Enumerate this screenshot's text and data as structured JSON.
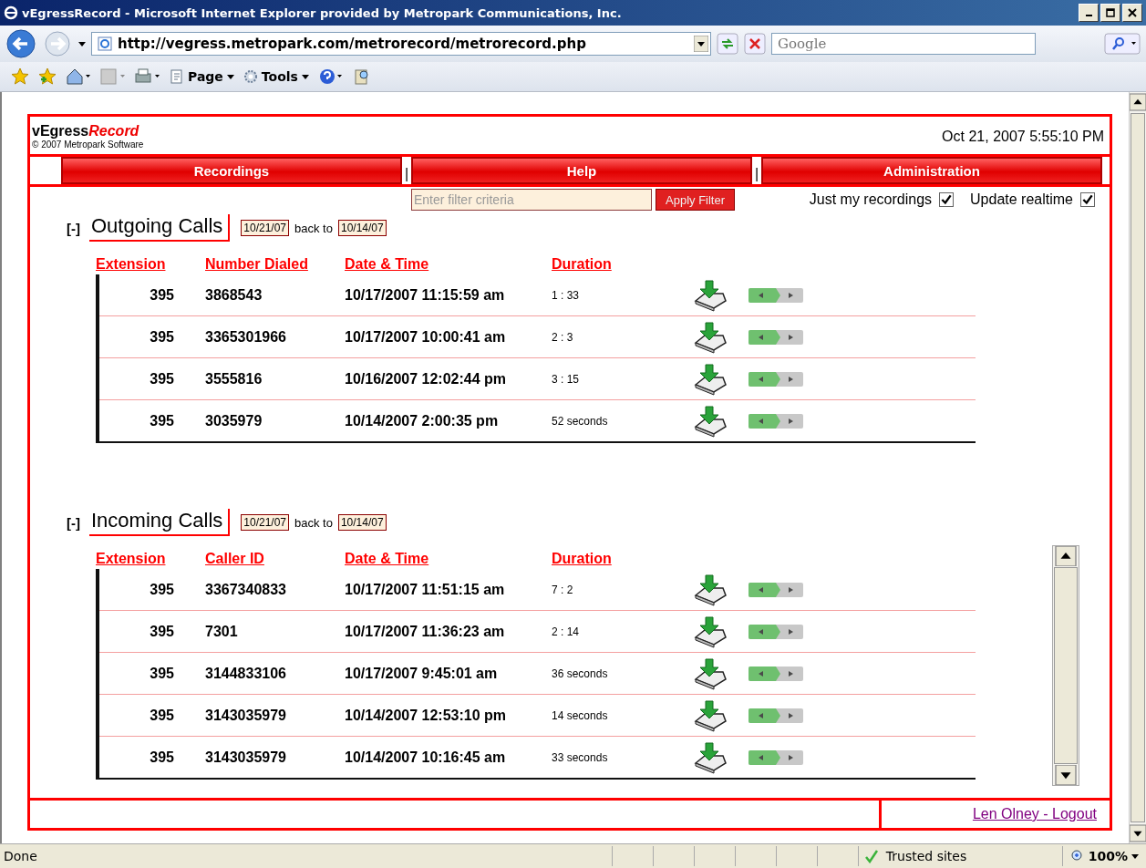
{
  "window": {
    "title": "vEgressRecord - Microsoft Internet Explorer provided by Metropark Communications, Inc."
  },
  "address_bar": {
    "url": "http://vegress.metropark.com/metrorecord/metrorecord.php",
    "search_placeholder": "Google"
  },
  "command_bar": {
    "items": [
      {
        "label": "Page"
      },
      {
        "label": "Tools"
      }
    ]
  },
  "page": {
    "brand": "vEgress",
    "brand_accent": "Record",
    "copyright": "© 2007 Metropark Software",
    "datetime": "Oct 21, 2007 5:55:10 PM",
    "nav": [
      {
        "label": "Recordings"
      },
      {
        "label": "Help"
      },
      {
        "label": "Administration"
      }
    ],
    "nav_separator": "|",
    "filter": {
      "placeholder": "Enter filter criteria",
      "button": "Apply Filter"
    },
    "options": [
      {
        "label": "Just my recordings",
        "checked": true
      },
      {
        "label": "Update realtime",
        "checked": true
      }
    ],
    "sections": [
      {
        "toggle": "[-]",
        "title": "Outgoing Calls",
        "from": "10/21/07",
        "back_to": "back to",
        "to": "10/14/07",
        "kind": "list",
        "columns": [
          "Extension",
          "Number Dialed",
          "Date & Time",
          "Duration"
        ],
        "rows": [
          [
            "395",
            "3868543",
            "10/17/2007 11:15:59 am",
            "1 : 33"
          ],
          [
            "395",
            "3365301966",
            "10/17/2007 10:00:41 am",
            "2 : 3"
          ],
          [
            "395",
            "3555816",
            "10/16/2007 12:02:44 pm",
            "3 : 15"
          ],
          [
            "395",
            "3035979",
            "10/14/2007 2:00:35 pm",
            "52 seconds"
          ]
        ]
      },
      {
        "toggle": "[-]",
        "title": "Incoming Calls",
        "from": "10/21/07",
        "back_to": "back to",
        "to": "10/14/07",
        "kind": "scrolling_list",
        "columns": [
          "Extension",
          "Caller ID",
          "Date & Time",
          "Duration"
        ],
        "rows": [
          [
            "395",
            "3367340833",
            "10/17/2007 11:51:15 am",
            "7 : 2"
          ],
          [
            "395",
            "7301",
            "10/17/2007 11:36:23 am",
            "2 : 14"
          ],
          [
            "395",
            "3144833106",
            "10/17/2007 9:45:01 am",
            "36 seconds"
          ],
          [
            "395",
            "3143035979",
            "10/14/2007 12:53:10 pm",
            "14 seconds"
          ],
          [
            "395",
            "3143035979",
            "10/14/2007 10:16:45 am",
            "33 seconds"
          ]
        ]
      }
    ],
    "footer_link": "Len Olney - Logout"
  },
  "status_bar": {
    "text": "Done",
    "zone": "Trusted sites",
    "zoom": "100%"
  }
}
